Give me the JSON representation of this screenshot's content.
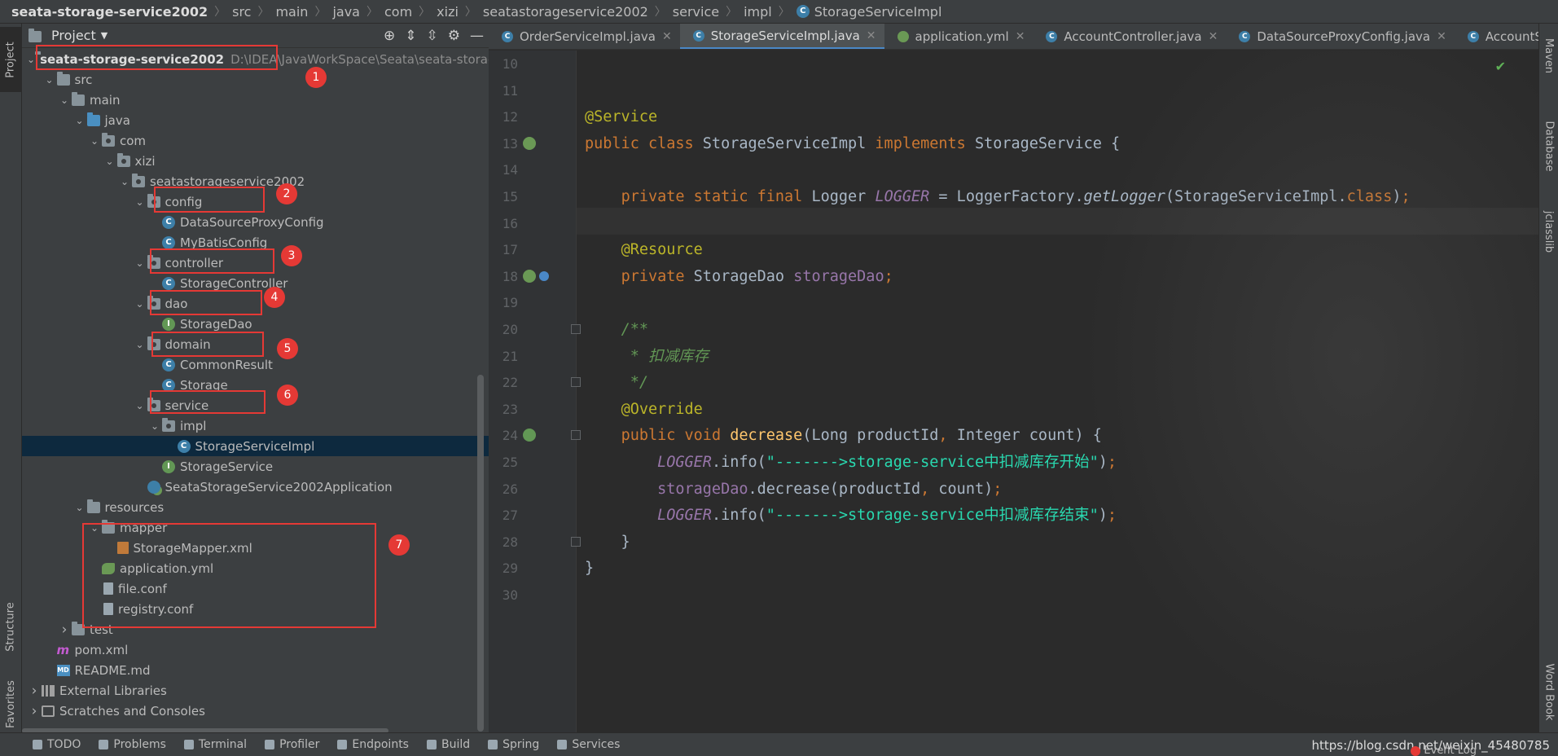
{
  "breadcrumb": [
    "seata-storage-service2002",
    "src",
    "main",
    "java",
    "com",
    "xizi",
    "seatastorageservice2002",
    "service",
    "impl",
    "StorageServiceImpl"
  ],
  "project_panel": {
    "title": "Project",
    "tree": [
      {
        "label": "seata-storage-service2002",
        "extra": "D:\\IDEA\\JavaWorkSpace\\Seata\\seata-storag",
        "indent": 0,
        "arrow": "down",
        "icon": "module-folder"
      },
      {
        "label": "src",
        "indent": 1,
        "arrow": "down",
        "icon": "folder"
      },
      {
        "label": "main",
        "indent": 2,
        "arrow": "down",
        "icon": "folder"
      },
      {
        "label": "java",
        "indent": 3,
        "arrow": "down",
        "icon": "source-folder"
      },
      {
        "label": "com",
        "indent": 4,
        "arrow": "down",
        "icon": "package"
      },
      {
        "label": "xizi",
        "indent": 5,
        "arrow": "down",
        "icon": "package"
      },
      {
        "label": "seatastorageservice2002",
        "indent": 6,
        "arrow": "down",
        "icon": "package"
      },
      {
        "label": "config",
        "indent": 7,
        "arrow": "down",
        "icon": "package"
      },
      {
        "label": "DataSourceProxyConfig",
        "indent": 8,
        "arrow": "none",
        "icon": "class"
      },
      {
        "label": "MyBatisConfig",
        "indent": 8,
        "arrow": "none",
        "icon": "class"
      },
      {
        "label": "controller",
        "indent": 7,
        "arrow": "down",
        "icon": "package"
      },
      {
        "label": "StorageController",
        "indent": 8,
        "arrow": "none",
        "icon": "class"
      },
      {
        "label": "dao",
        "indent": 7,
        "arrow": "down",
        "icon": "package"
      },
      {
        "label": "StorageDao",
        "indent": 8,
        "arrow": "none",
        "icon": "interface"
      },
      {
        "label": "domain",
        "indent": 7,
        "arrow": "down",
        "icon": "package"
      },
      {
        "label": "CommonResult",
        "indent": 8,
        "arrow": "none",
        "icon": "class"
      },
      {
        "label": "Storage",
        "indent": 8,
        "arrow": "none",
        "icon": "class"
      },
      {
        "label": "service",
        "indent": 7,
        "arrow": "down",
        "icon": "package"
      },
      {
        "label": "impl",
        "indent": 8,
        "arrow": "down",
        "icon": "package"
      },
      {
        "label": "StorageServiceImpl",
        "indent": 9,
        "arrow": "none",
        "icon": "class",
        "selected": true
      },
      {
        "label": "StorageService",
        "indent": 8,
        "arrow": "none",
        "icon": "interface"
      },
      {
        "label": "SeataStorageService2002Application",
        "indent": 7,
        "arrow": "none",
        "icon": "spring-app"
      },
      {
        "label": "resources",
        "indent": 3,
        "arrow": "down",
        "icon": "folder"
      },
      {
        "label": "mapper",
        "indent": 4,
        "arrow": "down",
        "icon": "folder"
      },
      {
        "label": "StorageMapper.xml",
        "indent": 5,
        "arrow": "none",
        "icon": "xml-file"
      },
      {
        "label": "application.yml",
        "indent": 4,
        "arrow": "none",
        "icon": "yml-file"
      },
      {
        "label": "file.conf",
        "indent": 4,
        "arrow": "none",
        "icon": "text-file"
      },
      {
        "label": "registry.conf",
        "indent": 4,
        "arrow": "none",
        "icon": "text-file"
      },
      {
        "label": "test",
        "indent": 2,
        "arrow": "right",
        "icon": "folder"
      },
      {
        "label": "pom.xml",
        "indent": 1,
        "arrow": "none",
        "icon": "maven-file"
      },
      {
        "label": "README.md",
        "indent": 1,
        "arrow": "none",
        "icon": "md-file"
      },
      {
        "label": "External Libraries",
        "indent": 0,
        "arrow": "right",
        "icon": "libraries"
      },
      {
        "label": "Scratches and Consoles",
        "indent": 0,
        "arrow": "right",
        "icon": "scratches"
      }
    ]
  },
  "annotations": [
    "1",
    "2",
    "3",
    "4",
    "5",
    "6",
    "7"
  ],
  "tabs": [
    {
      "label": "OrderServiceImpl.java",
      "icon": "class-icon",
      "active": false
    },
    {
      "label": "StorageServiceImpl.java",
      "icon": "class-icon",
      "active": true
    },
    {
      "label": "application.yml",
      "icon": "yml-icon",
      "active": false
    },
    {
      "label": "AccountController.java",
      "icon": "class-icon",
      "active": false
    },
    {
      "label": "DataSourceProxyConfig.java",
      "icon": "class-icon",
      "active": false
    },
    {
      "label": "AccountServ",
      "icon": "class-icon",
      "active": false
    }
  ],
  "editor": {
    "line_numbers": [
      "10",
      "11",
      "12",
      "13",
      "14",
      "15",
      "16",
      "17",
      "18",
      "19",
      "20",
      "21",
      "22",
      "23",
      "24",
      "25",
      "26",
      "27",
      "28",
      "29",
      "30"
    ],
    "lines": [
      [],
      [],
      [
        {
          "c": "an",
          "t": "@Service"
        }
      ],
      [
        {
          "c": "kw",
          "t": "public class "
        },
        {
          "c": "cn",
          "t": "StorageServiceImpl "
        },
        {
          "c": "kw",
          "t": "implements "
        },
        {
          "c": "cn",
          "t": "StorageService {"
        }
      ],
      [],
      [
        {
          "c": "cn",
          "t": "    "
        },
        {
          "c": "kw",
          "t": "private static final "
        },
        {
          "c": "cn",
          "t": "Logger "
        },
        {
          "c": "fi",
          "t": "LOGGER"
        },
        {
          "c": "cn",
          "t": " = LoggerFactory."
        },
        {
          "c": "mt",
          "t": "getLogger"
        },
        {
          "c": "cn",
          "t": "(StorageServiceImpl."
        },
        {
          "c": "kw",
          "t": "class"
        },
        {
          "c": "cn",
          "t": ")"
        },
        {
          "c": "kw",
          "t": ";"
        }
      ],
      [],
      [
        {
          "c": "cn",
          "t": "    "
        },
        {
          "c": "an",
          "t": "@Resource"
        }
      ],
      [
        {
          "c": "cn",
          "t": "    "
        },
        {
          "c": "kw",
          "t": "private "
        },
        {
          "c": "cn",
          "t": "StorageDao "
        },
        {
          "c": "fl",
          "t": "storageDao"
        },
        {
          "c": "kw",
          "t": ";"
        }
      ],
      [],
      [
        {
          "c": "cn",
          "t": "    "
        },
        {
          "c": "cm",
          "t": "/**"
        }
      ],
      [
        {
          "c": "cm",
          "t": "     * 扣减库存"
        }
      ],
      [
        {
          "c": "cm",
          "t": "     */"
        }
      ],
      [
        {
          "c": "cn",
          "t": "    "
        },
        {
          "c": "an",
          "t": "@Override"
        }
      ],
      [
        {
          "c": "cn",
          "t": "    "
        },
        {
          "c": "kw",
          "t": "public void "
        },
        {
          "c": "fn",
          "t": "decrease"
        },
        {
          "c": "cn",
          "t": "(Long productId"
        },
        {
          "c": "kw",
          "t": ", "
        },
        {
          "c": "cn",
          "t": "Integer count) {"
        }
      ],
      [
        {
          "c": "cn",
          "t": "        "
        },
        {
          "c": "fi",
          "t": "LOGGER"
        },
        {
          "c": "cn",
          "t": ".info("
        },
        {
          "c": "st2",
          "t": "\"------->storage-service中扣减库存开始\""
        },
        {
          "c": "cn",
          "t": ")"
        },
        {
          "c": "kw",
          "t": ";"
        }
      ],
      [
        {
          "c": "cn",
          "t": "        "
        },
        {
          "c": "fl",
          "t": "storageDao"
        },
        {
          "c": "cn",
          "t": ".decrease(productId"
        },
        {
          "c": "kw",
          "t": ", "
        },
        {
          "c": "cn",
          "t": "count)"
        },
        {
          "c": "kw",
          "t": ";"
        }
      ],
      [
        {
          "c": "cn",
          "t": "        "
        },
        {
          "c": "fi",
          "t": "LOGGER"
        },
        {
          "c": "cn",
          "t": ".info("
        },
        {
          "c": "st2",
          "t": "\"------->storage-service中扣减库存结束\""
        },
        {
          "c": "cn",
          "t": ")"
        },
        {
          "c": "kw",
          "t": ";"
        }
      ],
      [
        {
          "c": "cn",
          "t": "    }"
        }
      ],
      [
        {
          "c": "cn",
          "t": "}"
        }
      ],
      []
    ]
  },
  "left_strip": {
    "project": "Project",
    "structure": "Structure",
    "favorites": "Favorites"
  },
  "right_strip": {
    "maven": "Maven",
    "database": "Database",
    "jclasslib": "jclasslib",
    "wordbook": "Word Book"
  },
  "status_bar": {
    "items": [
      "TODO",
      "Problems",
      "Terminal",
      "Profiler",
      "Endpoints",
      "Build",
      "Spring",
      "Services"
    ],
    "url": "https://blog.csdn.net/weixin_45480785",
    "event_log": "Event Log"
  },
  "colors": {
    "annotation": "#e53935",
    "accent": "#4a88c7"
  }
}
